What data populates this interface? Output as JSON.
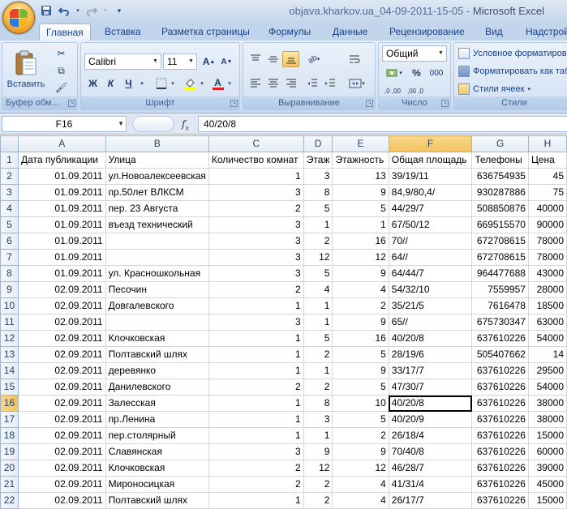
{
  "window": {
    "title_file": "objava.kharkov.ua_04-09-2011-15-05",
    "title_sep": " - ",
    "title_app": "Microsoft Excel"
  },
  "quick_access": [
    {
      "name": "save-icon",
      "glyph": "💾"
    },
    {
      "name": "undo-icon",
      "glyph": "↶"
    },
    {
      "name": "redo-icon",
      "glyph": "↷"
    },
    {
      "name": "customize-qat-icon",
      "glyph": "▾"
    }
  ],
  "tabs": [
    "Главная",
    "Вставка",
    "Разметка страницы",
    "Формулы",
    "Данные",
    "Рецензирование",
    "Вид",
    "Надстрой"
  ],
  "ribbon": {
    "clipboard": {
      "label": "Буфер обм...",
      "paste_label": "Вставить"
    },
    "font": {
      "label": "Шрифт",
      "font_name": "Calibri",
      "font_size": "11",
      "bold": "Ж",
      "italic": "К",
      "underline": "Ч",
      "grow": "Aˆ",
      "shrink": "Aˇ",
      "color_a": "A"
    },
    "alignment": {
      "label": "Выравнивание"
    },
    "number": {
      "label": "Число",
      "format": "Общий",
      "percent": "%",
      "thousands": "000",
      "inc_dec": ",0 ,00",
      "dec_dec": ",00 ,0"
    },
    "styles": {
      "label": "Стили",
      "conditional": "Условное форматирование",
      "format_table": "Форматировать как таблицу",
      "cell_styles": "Стили ячеек"
    }
  },
  "formula_bar": {
    "cell_ref": "F16",
    "fx": "fx",
    "content": "40/20/8"
  },
  "accent": {
    "selected_header": "#f1c15f",
    "ribbon_text": "#15428b"
  },
  "grid": {
    "columns": [
      "A",
      "B",
      "C",
      "D",
      "E",
      "F",
      "G",
      "H"
    ],
    "selected_column": "F",
    "selected_row": 16,
    "rows": [
      {
        "n": "1",
        "cells": [
          "Дата публикации",
          "Улица",
          "Количество комнат",
          "Этаж",
          "Этажность",
          "Общая площадь",
          "Телефоны",
          "Цена"
        ]
      },
      {
        "n": "2",
        "cells": [
          "01.09.2011",
          "ул.Новоалексеевская",
          "1",
          "3",
          "13",
          "39/19/11",
          "636754935",
          "45"
        ]
      },
      {
        "n": "3",
        "cells": [
          "01.09.2011",
          "пр.50лет ВЛКСМ",
          "3",
          "8",
          "9",
          "84,9/80,4/",
          "930287886",
          "75"
        ]
      },
      {
        "n": "4",
        "cells": [
          "01.09.2011",
          "пер. 23 Августа",
          "2",
          "5",
          "5",
          "44/29/7",
          "508850876",
          "40000"
        ]
      },
      {
        "n": "5",
        "cells": [
          "01.09.2011",
          "въезд технический",
          "3",
          "1",
          "1",
          "67/50/12",
          "669515570",
          "90000"
        ]
      },
      {
        "n": "6",
        "cells": [
          "01.09.2011",
          "",
          "3",
          "2",
          "16",
          "70//",
          "672708615",
          "78000"
        ]
      },
      {
        "n": "7",
        "cells": [
          "01.09.2011",
          "",
          "3",
          "12",
          "12",
          "64//",
          "672708615",
          "78000"
        ]
      },
      {
        "n": "8",
        "cells": [
          "01.09.2011",
          "ул. Красношкольная",
          "3",
          "5",
          "9",
          "64/44/7",
          "964477688",
          "43000"
        ]
      },
      {
        "n": "9",
        "cells": [
          "02.09.2011",
          "Песочин",
          "2",
          "4",
          "4",
          "54/32/10",
          "7559957",
          "28000"
        ]
      },
      {
        "n": "10",
        "cells": [
          "02.09.2011",
          "Довгалевского",
          "1",
          "1",
          "2",
          "35/21/5",
          "7616478",
          "18500"
        ]
      },
      {
        "n": "11",
        "cells": [
          "02.09.2011",
          "",
          "3",
          "1",
          "9",
          "65//",
          "675730347",
          "63000"
        ]
      },
      {
        "n": "12",
        "cells": [
          "02.09.2011",
          "Клочковская",
          "1",
          "5",
          "16",
          "40/20/8",
          "637610226",
          "54000"
        ]
      },
      {
        "n": "13",
        "cells": [
          "02.09.2011",
          "Полтавский шлях",
          "1",
          "2",
          "5",
          "28/19/6",
          "505407662",
          "14"
        ]
      },
      {
        "n": "14",
        "cells": [
          "02.09.2011",
          "деревянко",
          "1",
          "1",
          "9",
          "33/17/7",
          "637610226",
          "29500"
        ]
      },
      {
        "n": "15",
        "cells": [
          "02.09.2011",
          "Данилевского",
          "2",
          "2",
          "5",
          "47/30/7",
          "637610226",
          "54000"
        ]
      },
      {
        "n": "16",
        "cells": [
          "02.09.2011",
          "Залесская",
          "1",
          "8",
          "10",
          "40/20/8",
          "637610226",
          "38000"
        ]
      },
      {
        "n": "17",
        "cells": [
          "02.09.2011",
          "пр.Ленина",
          "1",
          "3",
          "5",
          "40/20/9",
          "637610226",
          "38000"
        ]
      },
      {
        "n": "18",
        "cells": [
          "02.09.2011",
          "пер.столярный",
          "1",
          "1",
          "2",
          "26/18/4",
          "637610226",
          "15000"
        ]
      },
      {
        "n": "19",
        "cells": [
          "02.09.2011",
          "Славянская",
          "3",
          "9",
          "9",
          "70/40/8",
          "637610226",
          "60000"
        ]
      },
      {
        "n": "20",
        "cells": [
          "02.09.2011",
          "Клочковская",
          "2",
          "12",
          "12",
          "46/28/7",
          "637610226",
          "39000"
        ]
      },
      {
        "n": "21",
        "cells": [
          "02.09.2011",
          "Мироносицкая",
          "2",
          "2",
          "4",
          "41/31/4",
          "637610226",
          "45000"
        ]
      },
      {
        "n": "22",
        "cells": [
          "02.09.2011",
          "Полтавский шлях",
          "1",
          "2",
          "4",
          "26/17/7",
          "637610226",
          "15000"
        ]
      }
    ]
  }
}
